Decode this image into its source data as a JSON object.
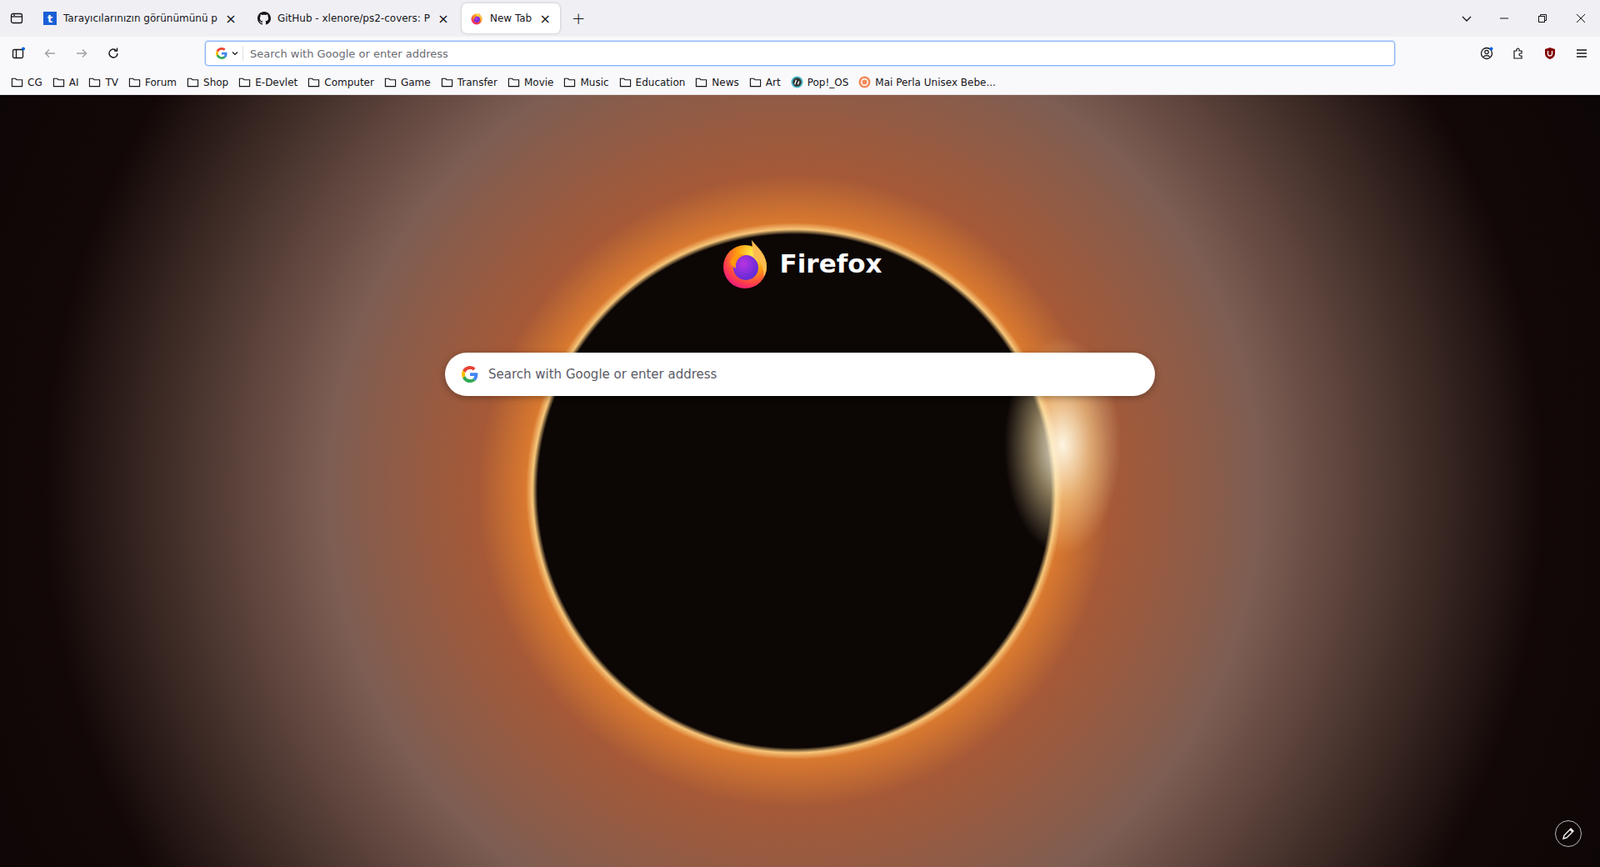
{
  "tabs": [
    {
      "label": "Tarayıcılarınızın görünümünü p",
      "selected": false,
      "favicon": {
        "kind": "letter",
        "text": "t"
      },
      "close": "×"
    },
    {
      "label": "GitHub - xlenore/ps2-covers: P",
      "selected": false,
      "favicon": {
        "kind": "github",
        "text": ""
      },
      "close": "×"
    },
    {
      "label": "New Tab",
      "selected": true,
      "favicon": {
        "kind": "firefox",
        "text": ""
      },
      "close": "×"
    }
  ],
  "new_tab_button": "+",
  "address_bar": {
    "placeholder": "Search with Google or enter address",
    "focused": true
  },
  "bookmarks": [
    {
      "label": "CG",
      "kind": "folder"
    },
    {
      "label": "AI",
      "kind": "folder"
    },
    {
      "label": "TV",
      "kind": "folder"
    },
    {
      "label": "Forum",
      "kind": "folder"
    },
    {
      "label": "Shop",
      "kind": "folder"
    },
    {
      "label": "E-Devlet",
      "kind": "folder"
    },
    {
      "label": "Computer",
      "kind": "folder"
    },
    {
      "label": "Game",
      "kind": "folder"
    },
    {
      "label": "Transfer",
      "kind": "folder"
    },
    {
      "label": "Movie",
      "kind": "folder"
    },
    {
      "label": "Music",
      "kind": "folder"
    },
    {
      "label": "Education",
      "kind": "folder"
    },
    {
      "label": "News",
      "kind": "folder"
    },
    {
      "label": "Art",
      "kind": "folder"
    },
    {
      "label": "Pop!_OS",
      "kind": "pop-os"
    },
    {
      "label": "Mai Perla Unisex Bebe...",
      "kind": "mai-perla"
    }
  ],
  "new_tab_page": {
    "brand": "Firefox",
    "search": {
      "placeholder": "Search with Google or enter address"
    }
  }
}
